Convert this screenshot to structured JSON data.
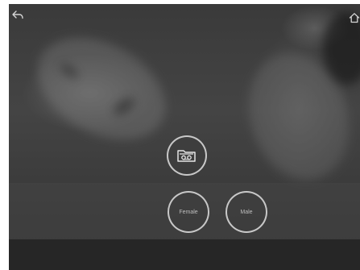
{
  "toolbar": {
    "back_icon": "back-arrow-icon",
    "home_icon": "home-icon"
  },
  "actions": {
    "cassette_icon": "cassette-icon",
    "female_label": "Female",
    "male_label": "Male"
  }
}
